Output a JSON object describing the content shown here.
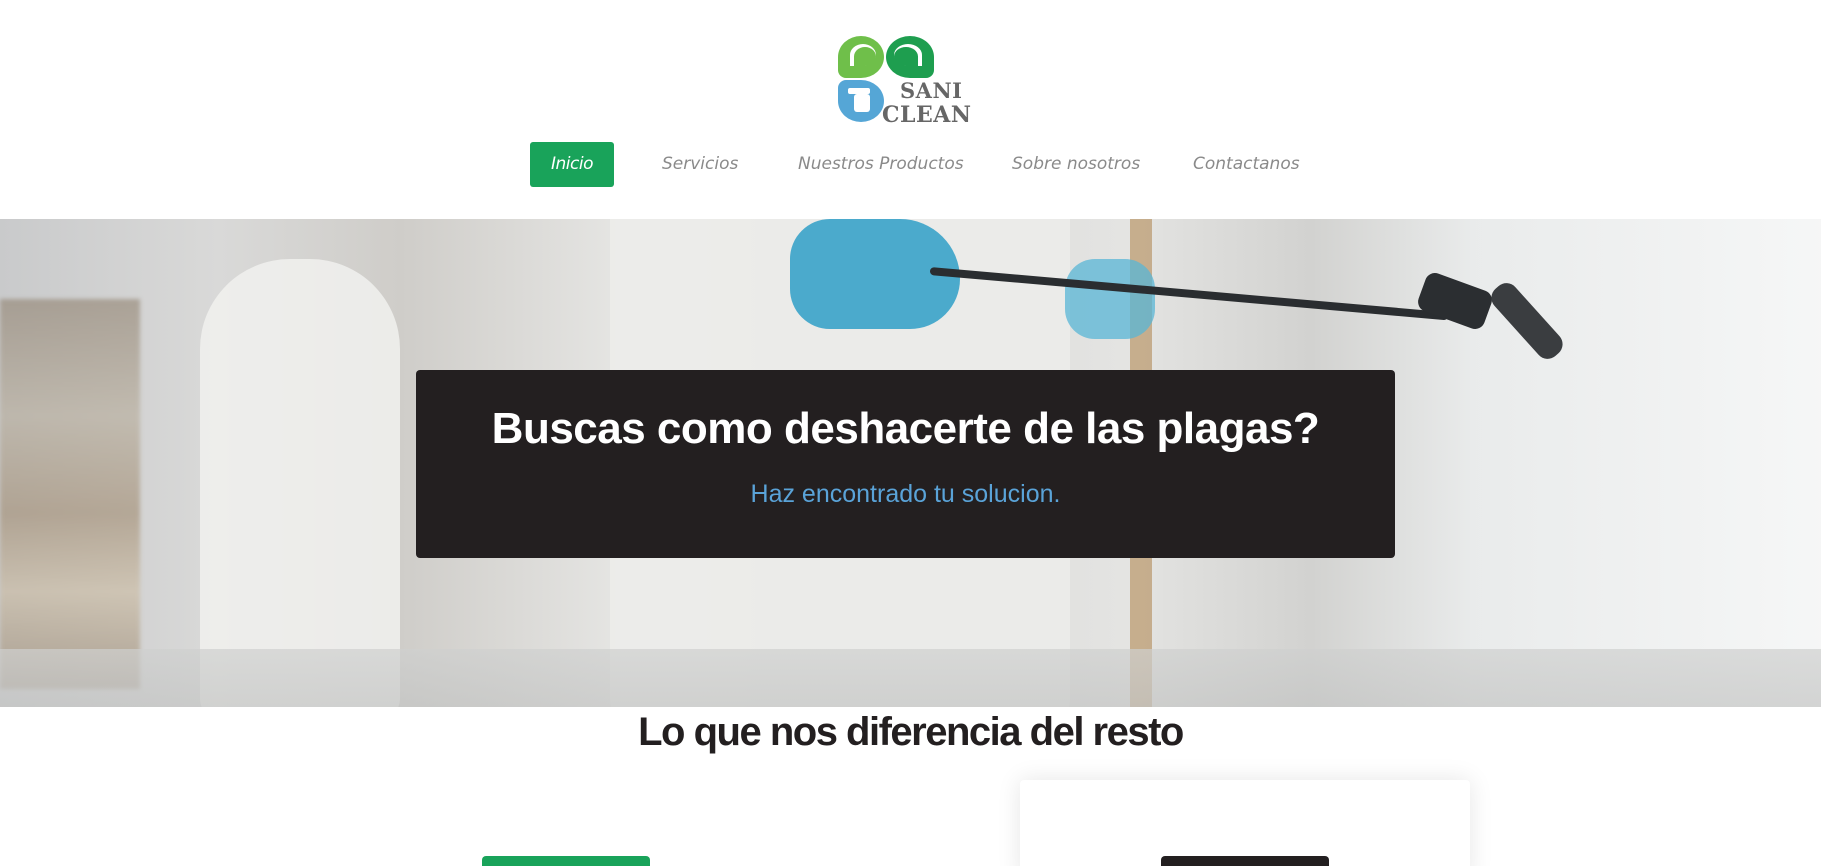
{
  "logo": {
    "line1": "SANI",
    "line2": "CLEAN"
  },
  "nav": {
    "items": [
      {
        "label": "Inicio",
        "active": true
      },
      {
        "label": "Servicios",
        "active": false
      },
      {
        "label": "Nuestros Productos",
        "active": false
      },
      {
        "label": "Sobre nosotros",
        "active": false
      },
      {
        "label": "Contactanos",
        "active": false
      }
    ]
  },
  "hero": {
    "title": "Buscas como deshacerte de las plagas?",
    "subtitle": "Haz encontrado tu solucion."
  },
  "section": {
    "title": "Lo que nos diferencia del resto"
  },
  "colors": {
    "accent": "#19a35a",
    "dark": "#231f20",
    "subtitle": "#5aa3d8"
  }
}
